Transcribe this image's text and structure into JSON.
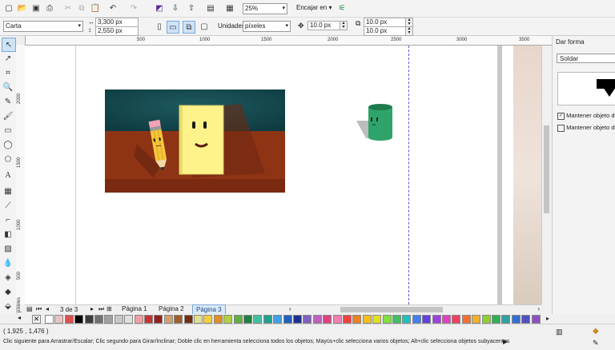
{
  "toolbar": {
    "zoom_value": "25%",
    "snap_label": "Encajar en",
    "icons": [
      "new-icon",
      "open-icon",
      "save-icon",
      "print-icon",
      "cut-icon",
      "copy-icon",
      "paste-icon",
      "undo-icon",
      "redo-icon",
      "import-icon",
      "export-icon",
      "publish-icon",
      "app-launcher-icon",
      "options-icon"
    ]
  },
  "propbar": {
    "page_size": "Carta",
    "width": "3,300 px",
    "height": "2,550 px",
    "units_label": "Unidades:",
    "units_value": "píxeles",
    "nudge": "10.0 px",
    "dup_x": "10.0 px",
    "dup_y": "10.0 px"
  },
  "ruler": {
    "h_ticks": [
      "500",
      "1000",
      "1500",
      "2000",
      "2500",
      "3000",
      "3500"
    ],
    "v_ticks": [
      "2000",
      "1500",
      "1000",
      "500",
      "0"
    ],
    "unit": "píxeles"
  },
  "docker": {
    "title": "Dar forma",
    "mode": "Soldar",
    "keep_source": "Mantener objeto de",
    "keep_target": "Mantener objeto des"
  },
  "page_nav": {
    "counter": "3 de 3",
    "tabs": [
      "Página 1",
      "Página 2",
      "Página 3"
    ],
    "active": "Página 3"
  },
  "status": {
    "coords": "( 1,925 , 1,476 )",
    "hint": "Clic siguiente para Arrastrar/Escalar; Clic segundo para Girar/Inclinar; Doble clic en herramienta selecciona todos los objetos; Mayús+clic selecciona varios objetos; Alt+clic selecciona objetos subyacentes"
  },
  "palette": [
    "#ffffff",
    "#e8c3c3",
    "#e05050",
    "#000000",
    "#3c3c3c",
    "#707070",
    "#a0a0a0",
    "#c8c8c8",
    "#e0e0e0",
    "#f0a0a0",
    "#c83232",
    "#902020",
    "#d0a070",
    "#a0602a",
    "#703010",
    "#e0e090",
    "#f0d040",
    "#e09020",
    "#b0d040",
    "#60b040",
    "#208040",
    "#40c0a0",
    "#20a090",
    "#40a0e0",
    "#2060c0",
    "#203090",
    "#8060c0",
    "#c060c0",
    "#e04080",
    "#f080b0",
    "#f04040",
    "#f08020",
    "#f0c020",
    "#e0e020",
    "#80e040",
    "#40c060",
    "#20c0c0",
    "#4080f0",
    "#6040e0",
    "#a040e0",
    "#e040c0",
    "#f04060",
    "#f07030",
    "#f0b030",
    "#90d030",
    "#30b050",
    "#30a0a0",
    "#3070d0",
    "#5050c0",
    "#9050c0"
  ]
}
